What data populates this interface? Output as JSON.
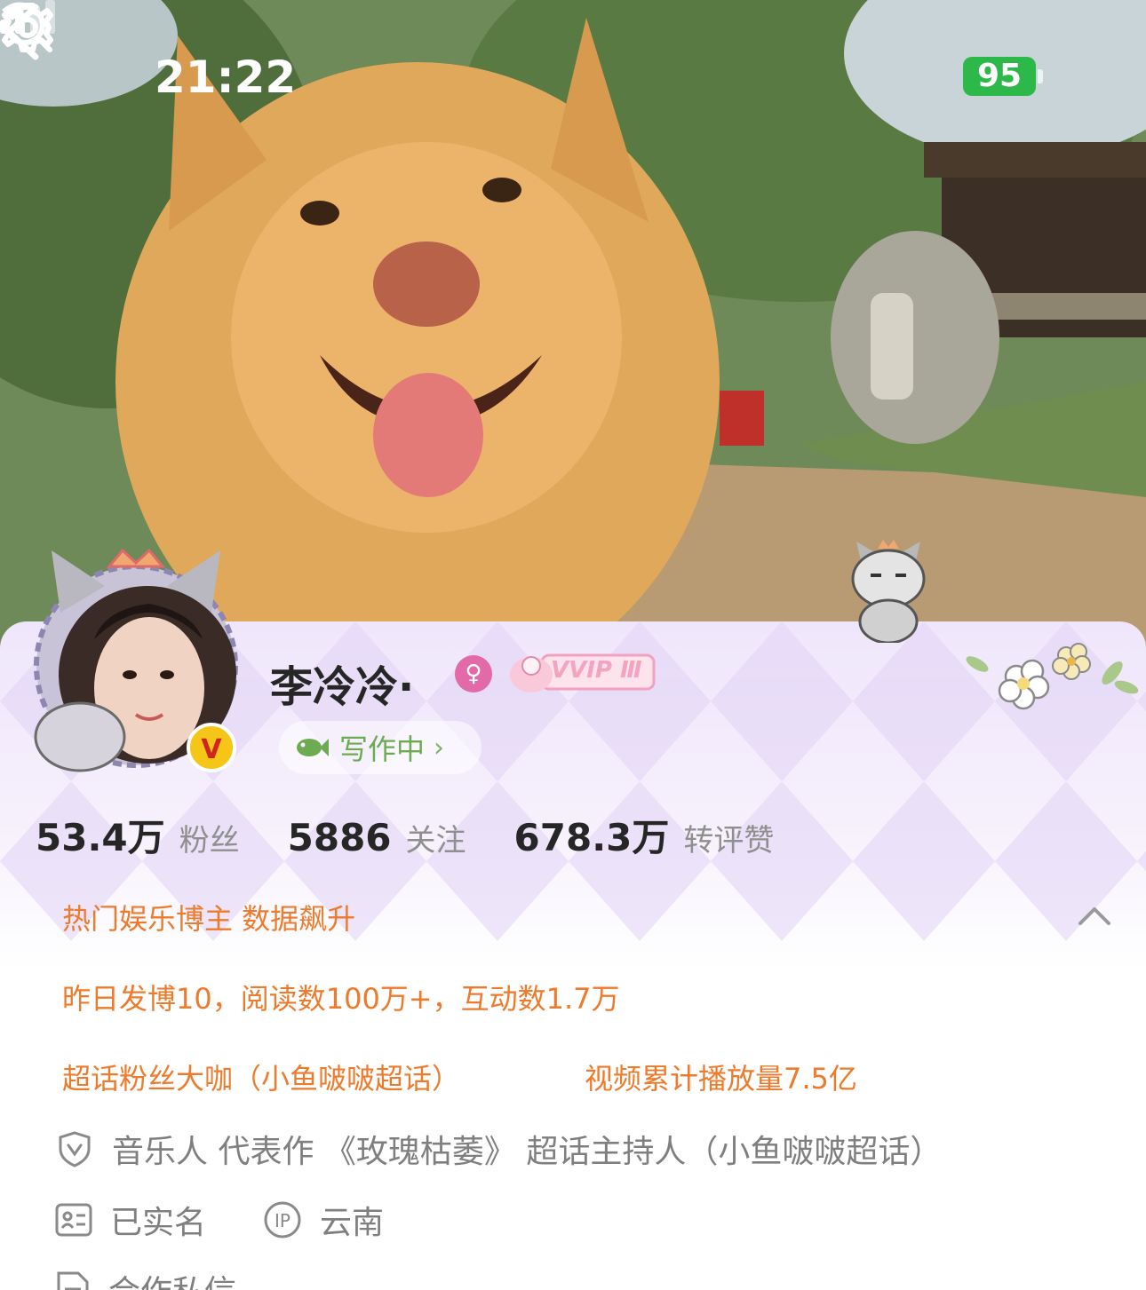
{
  "status_bar": {
    "time": "21:22",
    "battery": "95"
  },
  "nav": {
    "back": "back",
    "search": "search",
    "settings": "settings"
  },
  "profile": {
    "name": "李冷冷·",
    "gender_symbol": "♀",
    "vip_label": "VVIP Ⅲ",
    "status_text": "写作中",
    "status_chevron": "›"
  },
  "stats": [
    {
      "value": "53.4万",
      "label": "粉丝"
    },
    {
      "value": "5886",
      "label": "关注"
    },
    {
      "value": "678.3万",
      "label": "转评赞"
    }
  ],
  "highlights": {
    "title": "热门娱乐博主 数据飙升",
    "yesterday": "昨日发博10，阅读数100万+，互动数1.7万",
    "super_topic": "超话粉丝大咖（小鱼啵啵超话）",
    "video_plays": "视频累计播放量7.5亿"
  },
  "info": {
    "verification": "音乐人 代表作 《玫瑰枯萎》 超话主持人（小鱼啵啵超话）",
    "real_name": "已实名",
    "ip_location": "云南",
    "business": "合作私信"
  },
  "colors": {
    "accent_orange": "#ee7a2c",
    "status_green": "#6cab52",
    "verified_yellow": "#f5c518",
    "gender_pink": "#e36aa9"
  }
}
